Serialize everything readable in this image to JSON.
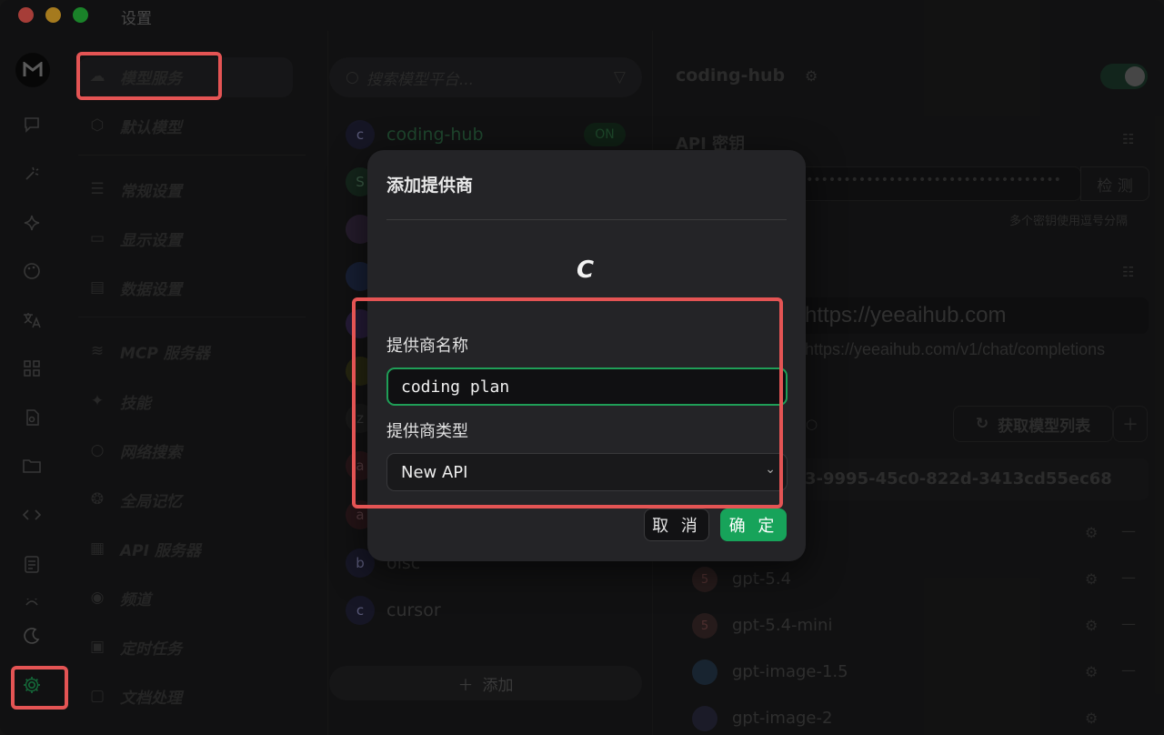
{
  "window": {
    "title": "设置"
  },
  "colors": {
    "accent": "#17a35a",
    "highlight": "#e45454",
    "close": "#ff5f57",
    "minimize": "#febc2e",
    "zoom": "#28c840"
  },
  "rail_icons": [
    "chat-icon",
    "magic-wand-icon",
    "sparkle-icon",
    "palette-icon",
    "translate-icon",
    "apps-grid-icon",
    "file-search-icon",
    "folder-icon",
    "code-icon",
    "notes-icon",
    "robot-icon",
    "moon-icon",
    "settings-gear-icon"
  ],
  "settings_nav": [
    {
      "label": "模型服务",
      "icon": "cloud-icon"
    },
    {
      "label": "默认模型",
      "icon": "cube-icon"
    },
    {
      "label": "常规设置",
      "icon": "sliders-icon"
    },
    {
      "label": "显示设置",
      "icon": "monitor-icon"
    },
    {
      "label": "数据设置",
      "icon": "database-icon"
    },
    {
      "label": "MCP 服务器",
      "icon": "mcp-icon"
    },
    {
      "label": "技能",
      "icon": "skill-sparkle-icon"
    },
    {
      "label": "网络搜索",
      "icon": "search-icon"
    },
    {
      "label": "全局记忆",
      "icon": "brain-icon"
    },
    {
      "label": "API 服务器",
      "icon": "server-icon"
    },
    {
      "label": "频道",
      "icon": "broadcast-icon"
    },
    {
      "label": "定时任务",
      "icon": "calendar-clock-icon"
    },
    {
      "label": "文档处理",
      "icon": "document-icon"
    }
  ],
  "provider_list": {
    "search_placeholder": "搜索模型平台...",
    "items": [
      {
        "avatar": "c",
        "name": "coding-hub",
        "badge": "ON"
      },
      {
        "avatar": "S",
        "name": ""
      },
      {
        "avatar": "",
        "name": ""
      },
      {
        "avatar": "",
        "name": ""
      },
      {
        "avatar": "",
        "name": ""
      },
      {
        "avatar": "",
        "name": ""
      },
      {
        "avatar": "z",
        "name": ""
      },
      {
        "avatar": "a",
        "name": ""
      },
      {
        "avatar": "a",
        "name": ""
      },
      {
        "avatar": "b",
        "name": "olsc"
      },
      {
        "avatar": "c",
        "name": "cursor"
      }
    ],
    "add_label": "添加"
  },
  "detail": {
    "provider_title": "coding-hub",
    "api_key_label": "API 密钥",
    "check_button": "检 测",
    "key_hint": "多个密钥使用逗号分隔",
    "api_host": "https://yeeaihub.com",
    "api_preview": "https://yeeaihub.com/v1/chat/completions",
    "fetch_models_button": "获取模型列表",
    "model_group_id": "3-9995-45c0-822d-3413cd55ec68",
    "models": [
      "gpt-5.4",
      "gpt-5.4-mini",
      "gpt-image-1.5",
      "gpt-image-2"
    ]
  },
  "modal": {
    "title": "添加提供商",
    "logo_letter": "C",
    "name_label": "提供商名称",
    "name_value": "coding plan",
    "type_label": "提供商类型",
    "type_value": "New API",
    "cancel": "取 消",
    "confirm": "确 定"
  }
}
